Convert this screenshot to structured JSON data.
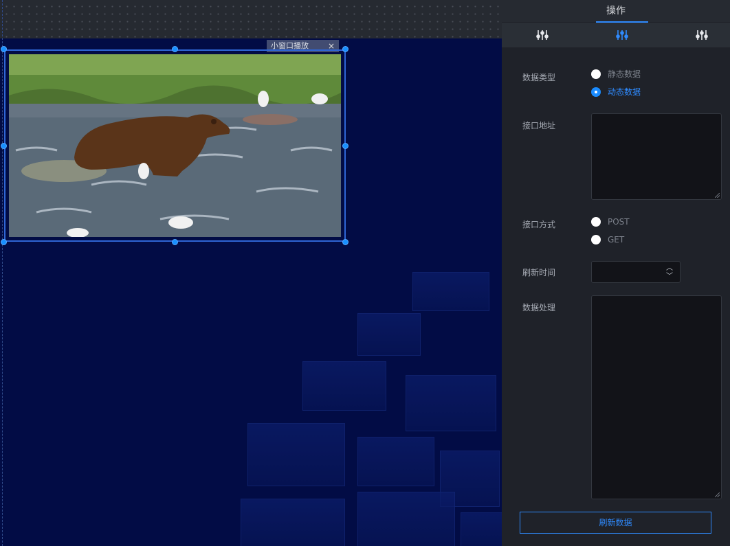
{
  "widget": {
    "tag_label": "小窗口播放",
    "tag_close": "×"
  },
  "panel": {
    "title": "操作",
    "tools": [
      {
        "icon": "sliders-icon"
      },
      {
        "icon": "sliders-icon",
        "active": true
      },
      {
        "icon": "sliders-icon"
      }
    ],
    "data_type": {
      "label": "数据类型",
      "options": [
        "静态数据",
        "动态数据"
      ],
      "selected": "动态数据"
    },
    "api_url": {
      "label": "接口地址",
      "value": ""
    },
    "api_method": {
      "label": "接口方式",
      "options": [
        "POST",
        "GET"
      ],
      "selected": ""
    },
    "refresh_time": {
      "label": "刷新时间",
      "value": ""
    },
    "data_processing": {
      "label": "数据处理",
      "value": ""
    },
    "refresh_button": "刷新数据"
  },
  "colors": {
    "accent": "#2f8bff",
    "panel_bg": "#1f2229",
    "canvas_bg": "#020c45",
    "selection": "#1890ff"
  }
}
